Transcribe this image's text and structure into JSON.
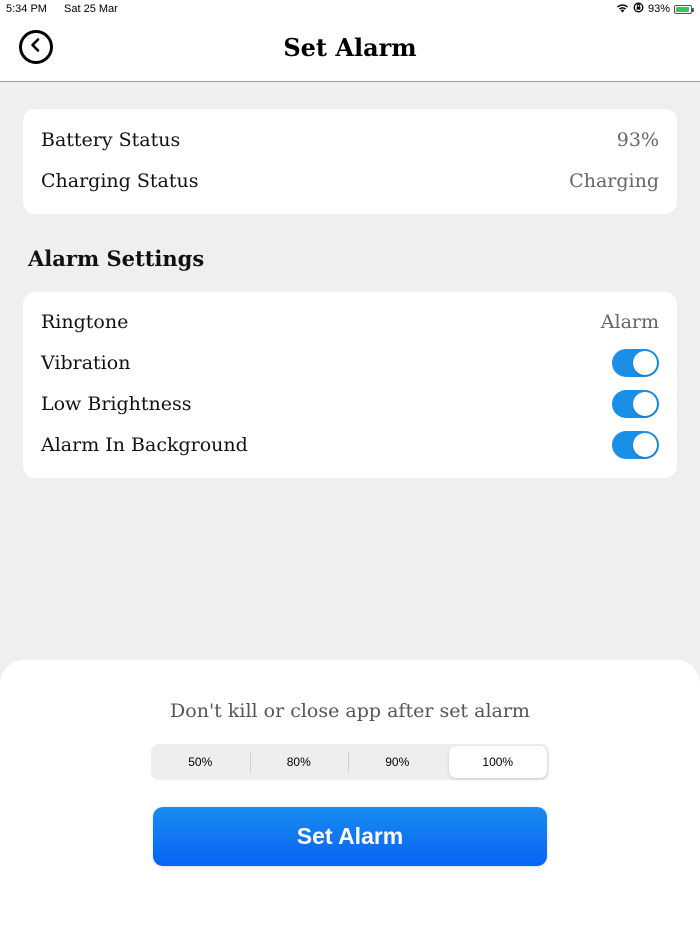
{
  "status_bar": {
    "time": "5:34 PM",
    "date": "Sat 25 Mar",
    "battery_percent": "93%",
    "battery_level": 0.93,
    "icons": [
      "wifi-icon",
      "orientation-lock-icon",
      "battery-charging-icon"
    ]
  },
  "nav": {
    "title": "Set Alarm",
    "back_icon": "chevron-left-circle-icon"
  },
  "battery_card": {
    "rows": [
      {
        "label": "Battery Status",
        "value": "93%"
      },
      {
        "label": "Charging Status",
        "value": "Charging"
      }
    ]
  },
  "alarm_settings": {
    "title": "Alarm Settings",
    "ringtone": {
      "label": "Ringtone",
      "value": "Alarm"
    },
    "toggles": [
      {
        "label": "Vibration",
        "on": true
      },
      {
        "label": "Low Brightness",
        "on": true
      },
      {
        "label": "Alarm In Background",
        "on": true
      }
    ]
  },
  "bottom": {
    "warning": "Don't kill or close app after set alarm",
    "levels": [
      "50%",
      "80%",
      "90%",
      "100%"
    ],
    "selected_level": "100%",
    "button_label": "Set Alarm"
  },
  "colors": {
    "accent": "#1a8fe8",
    "button_top": "#1a8cf0",
    "button_bottom": "#0763f5",
    "background": "#efefef",
    "battery_fill": "#34c759"
  }
}
